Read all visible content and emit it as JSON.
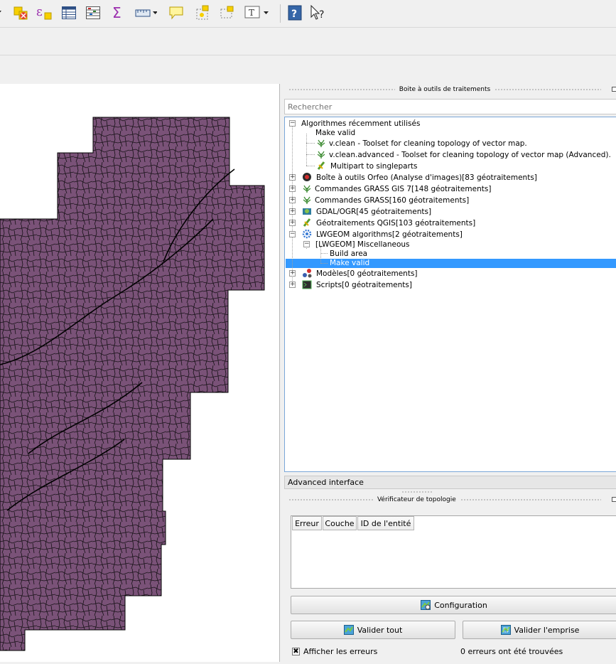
{
  "toolbar": {
    "icons": [
      "dropdown-arrow-icon",
      "deselect-features-icon",
      "expression-select-icon",
      "attribute-table-icon",
      "field-calculator-icon",
      "statistics-sum-icon",
      "measure-icon",
      "annotation-balloon-icon",
      "new-bookmark-icon",
      "show-bookmarks-icon",
      "text-annotation-icon",
      "help-book-icon",
      "whats-this-icon"
    ]
  },
  "processing": {
    "title": "Boite à outils de traitements",
    "search_placeholder": "Rechercher",
    "recent_group": "Algorithmes récemment utilisés",
    "recent_items": [
      "Make valid",
      "v.clean - Toolset for cleaning topology of vector map.",
      "v.clean.advanced - Toolset for cleaning topology of vector map (Advanced).",
      "Multipart to singleparts"
    ],
    "providers": [
      "Boîte à outils Orfeo (Analyse d'images)[83 géotraitements]",
      "Commandes GRASS GIS 7[148 géotraitements]",
      "Commandes GRASS[160 géotraitements]",
      "GDAL/OGR[45 géotraitements]",
      "Géotraitements QGIS[103 géotraitements]",
      "LWGEOM algorithms[2 géotraitements]"
    ],
    "lwgeom_group": "[LWGEOM] Miscellaneous",
    "lwgeom_items": [
      "Build area",
      "Make valid"
    ],
    "other_providers": [
      "Modèles[0 géotraitements]",
      "Scripts[0 géotraitements]"
    ],
    "advanced_label": "Advanced interface"
  },
  "topology": {
    "title": "Vérificateur de topologie",
    "columns": [
      "Erreur",
      "Couche",
      "ID de l'entité"
    ],
    "configuration_label": "Configuration",
    "validate_all_label": "Valider tout",
    "validate_extent_label": "Valider l'emprise",
    "show_errors_label": "Afficher les erreurs",
    "show_errors_checked": true,
    "status": "0 erreurs ont été trouvées"
  },
  "colors": {
    "map_fill": "#7a5278",
    "selection": "#3399ff",
    "tree_border": "#7aa7d8"
  }
}
